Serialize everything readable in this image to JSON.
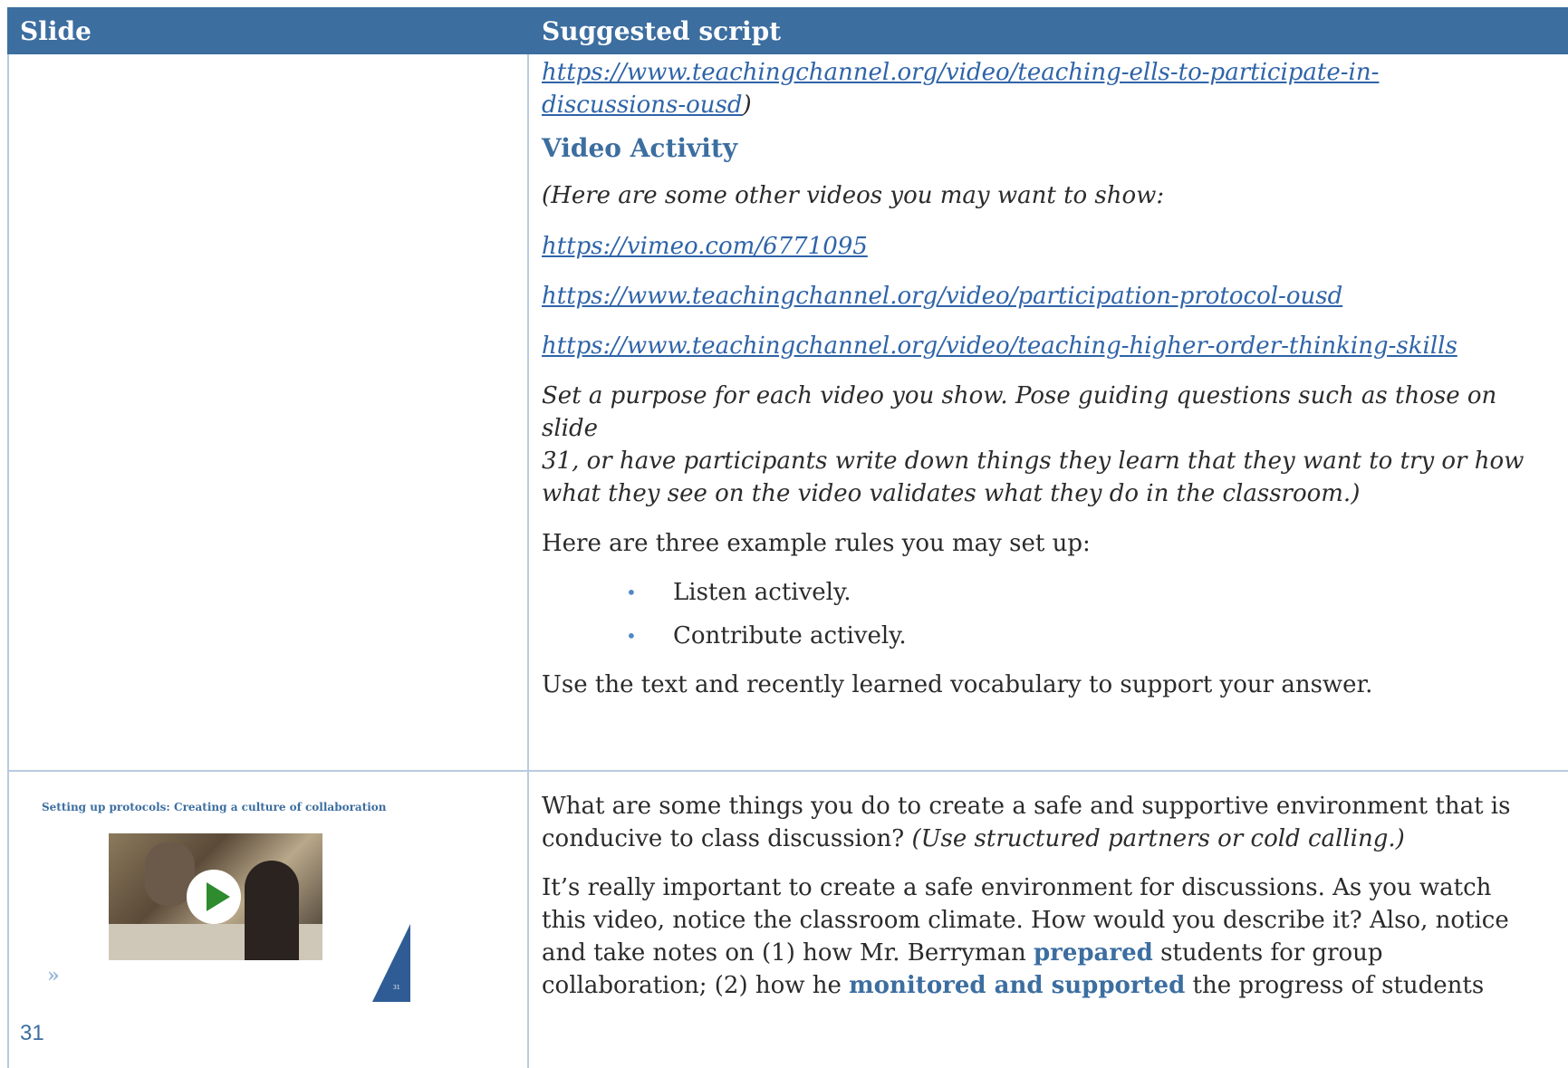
{
  "header": {
    "col1": "Slide",
    "col2": "Suggested script"
  },
  "row1": {
    "link_cont_a": "https://www.teachingchannel.org/video/teaching-ells-to-participate-in-",
    "link_cont_b": "discussions-ousd",
    "link_cont_close": ")",
    "heading": "Video Activity",
    "intro": "(Here are some other videos you may want to show:",
    "links": [
      "https://vimeo.com/6771095",
      "https://www.teachingchannel.org/video/participation-protocol-ousd",
      "https://www.teachingchannel.org/video/teaching-higher-order-thinking-skills"
    ],
    "purpose_l1": "Set a purpose for each video you show. Pose guiding questions such as those on slide",
    "purpose_l2": "31, or have participants write down things they learn that they want to try or how",
    "purpose_l3": "what they see on the video validates what they do in the classroom.)",
    "rules_intro": "Here are three example rules you may set up:",
    "rules": [
      "Listen actively.",
      "Contribute actively."
    ],
    "closing": "Use the text and recently learned vocabulary to support your answer."
  },
  "row2": {
    "slide": {
      "title": "Setting up protocols: Creating a culture of collaboration",
      "slide_number": "31",
      "page_number": "31"
    },
    "q_l1": "What are some things you do to create a safe and supportive environment that is",
    "q_l2a": "conducive to class discussion? ",
    "q_l2b": "(Use structured partners or cold calling.)",
    "p2_l1": "It’s really important to create a safe environment for discussions. As you watch",
    "p2_l2": "this video, notice the classroom climate. How would you describe it? Also, notice",
    "p2_l3a": "and take notes on (1) how Mr. Berryman ",
    "p2_l3b": "prepared",
    "p2_l3c": " students for group",
    "p2_l4a": "collaboration; (2) how he ",
    "p2_l4b": "monitored and supported",
    "p2_l4c": " the progress of students"
  }
}
